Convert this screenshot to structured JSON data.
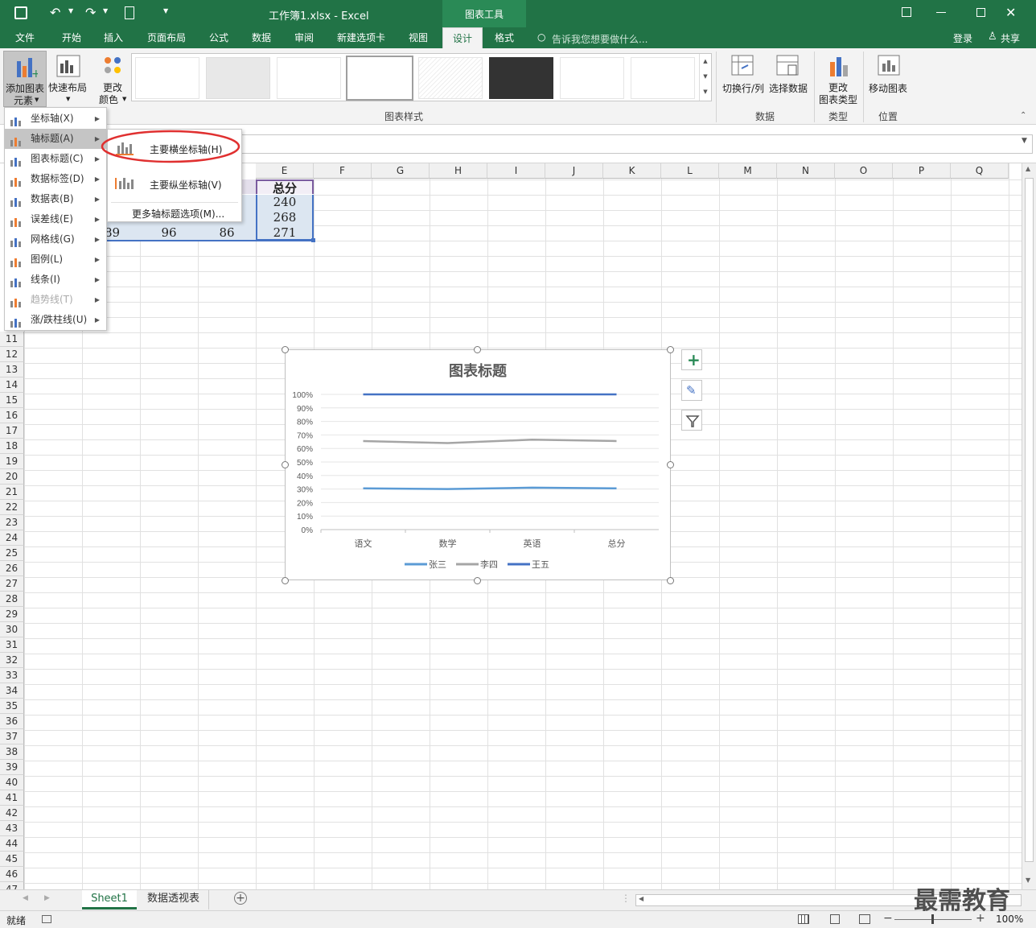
{
  "window": {
    "title": "工作簿1.xlsx - Excel",
    "context_tab": "图表工具"
  },
  "tabs": [
    "文件",
    "开始",
    "插入",
    "页面布局",
    "公式",
    "数据",
    "审阅",
    "新建选项卡",
    "视图",
    "设计",
    "格式"
  ],
  "tell_me": "告诉我您想要做什么...",
  "account": {
    "login": "登录",
    "share": "共享"
  },
  "ribbon": {
    "add_element_line1": "添加图表",
    "add_element_line2": "元素",
    "quick_layout": "快速布局",
    "change_colors_line1": "更改",
    "change_colors_line2": "颜色",
    "chart_styles_label": "图表样式",
    "switch_rowcol": "切换行/列",
    "select_data": "选择数据",
    "data_group": "数据",
    "change_type_line1": "更改",
    "change_type_line2": "图表类型",
    "type_group": "类型",
    "move_chart": "移动图表",
    "location_group": "位置"
  },
  "add_element_menu": [
    {
      "label": "坐标轴(X)",
      "enabled": true
    },
    {
      "label": "轴标题(A)",
      "enabled": true
    },
    {
      "label": "图表标题(C)",
      "enabled": true
    },
    {
      "label": "数据标签(D)",
      "enabled": true
    },
    {
      "label": "数据表(B)",
      "enabled": true
    },
    {
      "label": "误差线(E)",
      "enabled": true
    },
    {
      "label": "网格线(G)",
      "enabled": true
    },
    {
      "label": "图例(L)",
      "enabled": true
    },
    {
      "label": "线条(I)",
      "enabled": true
    },
    {
      "label": "趋势线(T)",
      "enabled": false
    },
    {
      "label": "涨/跌柱线(U)",
      "enabled": true
    }
  ],
  "axis_title_submenu": {
    "primary_horizontal": "主要横坐标轴(H)",
    "primary_vertical": "主要纵坐标轴(V)",
    "more_options": "更多轴标题选项(M)..."
  },
  "columns": [
    "E",
    "F",
    "G",
    "H",
    "I",
    "J",
    "K",
    "L",
    "M",
    "N",
    "O",
    "P",
    "Q"
  ],
  "table": {
    "header": "总分",
    "e_values": [
      "240",
      "268",
      "271"
    ],
    "row4": [
      "89",
      "96",
      "86"
    ]
  },
  "rows": [
    "11",
    "12",
    "13",
    "14",
    "15",
    "16",
    "17",
    "18",
    "19",
    "20",
    "21",
    "22",
    "23",
    "24",
    "25",
    "26",
    "27",
    "28",
    "29",
    "30",
    "31",
    "32",
    "33",
    "34",
    "35",
    "36",
    "37",
    "38",
    "39",
    "40",
    "41",
    "42",
    "43",
    "44",
    "45",
    "46",
    "47"
  ],
  "chart_data": {
    "type": "line",
    "title": "图表标题",
    "categories": [
      "语文",
      "数学",
      "英语",
      "总分"
    ],
    "y_ticks": [
      "100%",
      "90%",
      "80%",
      "70%",
      "60%",
      "50%",
      "40%",
      "30%",
      "20%",
      "10%",
      "0%"
    ],
    "ylim": [
      0,
      1
    ],
    "grid": true,
    "legend_placement": "bottom",
    "series": [
      {
        "name": "张三",
        "color": "#5b9bd5",
        "values": [
          0.305,
          0.3,
          0.31,
          0.305
        ]
      },
      {
        "name": "李四",
        "color": "#a5a5a5",
        "values": [
          0.655,
          0.64,
          0.665,
          0.655
        ]
      },
      {
        "name": "王五",
        "color": "#4472c4",
        "values": [
          1.0,
          1.0,
          1.0,
          1.0
        ]
      }
    ]
  },
  "sheets": [
    "Sheet1",
    "数据透视表"
  ],
  "status": {
    "ready": "就绪",
    "zoom": "100%"
  },
  "watermark": "最需教育"
}
